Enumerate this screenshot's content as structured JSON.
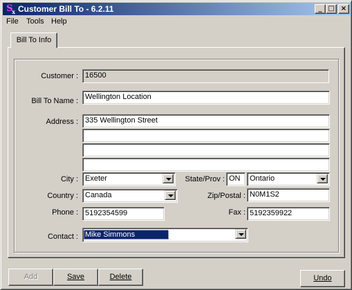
{
  "window": {
    "title": "Customer Bill To - 6.2.11",
    "icon": "S",
    "icon_sub": "x",
    "controls": {
      "minimize": "_",
      "maximize": "□",
      "close": "×"
    }
  },
  "menu": {
    "items": [
      "File",
      "Tools",
      "Help"
    ]
  },
  "tab": {
    "label": "Bill To Info"
  },
  "form": {
    "customer_label": "Customer :",
    "customer_value": "16500",
    "bill_to_name_label": "Bill To Name :",
    "bill_to_name_value": "Wellington Location",
    "address_label": "Address :",
    "address_lines": [
      "335 Wellington Street",
      "",
      "",
      ""
    ],
    "city_label": "City :",
    "city_value": "Exeter",
    "state_label": "State/Prov :",
    "state_code": "ON",
    "state_name": "Ontario",
    "country_label": "Country :",
    "country_value": "Canada",
    "zip_label": "Zip/Postal :",
    "zip_value": "N0M1S2",
    "phone_label": "Phone :",
    "phone_value": "5192354599",
    "fax_label": "Fax :",
    "fax_value": "5192359922",
    "contact_label": "Contact :",
    "contact_value": "Mike Simmons"
  },
  "buttons": {
    "add": "Add",
    "save": "Save",
    "delete": "Delete",
    "undo": "Undo"
  }
}
